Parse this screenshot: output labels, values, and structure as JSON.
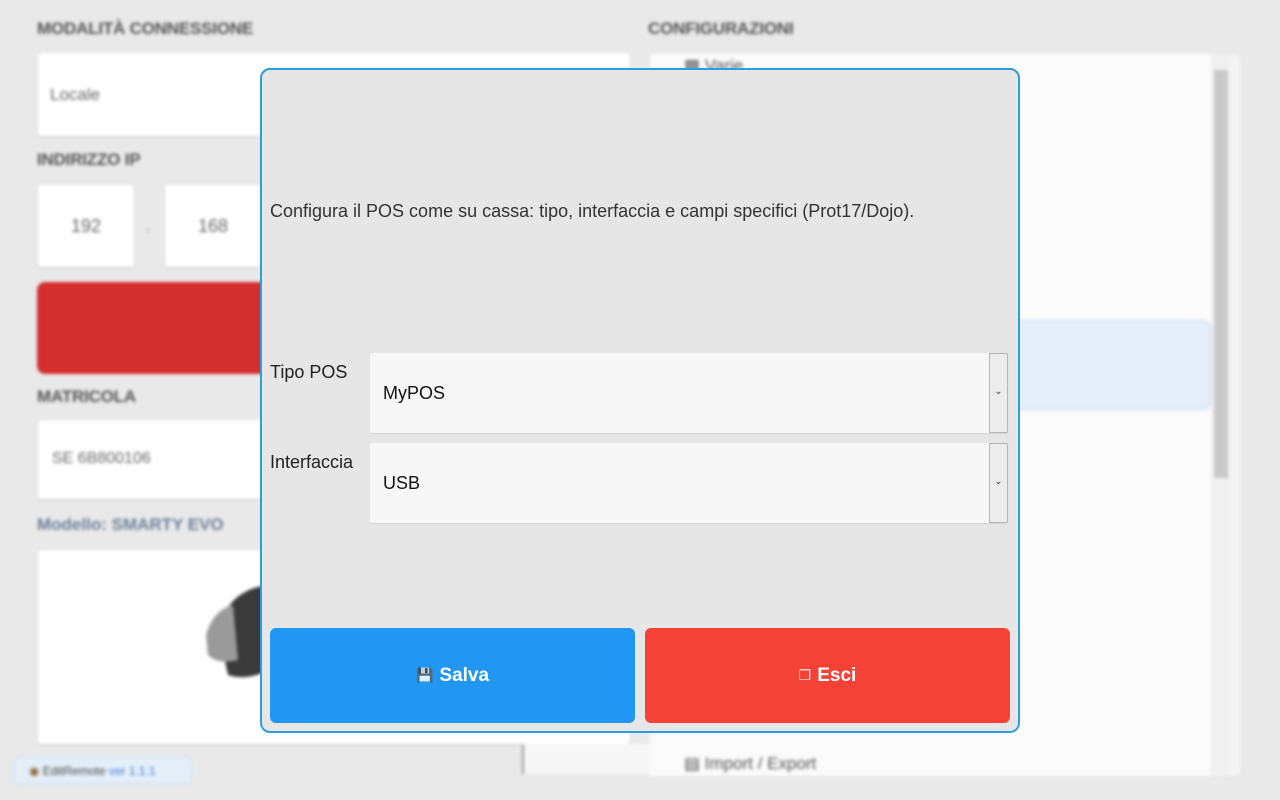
{
  "background": {
    "connection": {
      "title": "MODALITÀ CONNESSIONE",
      "value": "Locale"
    },
    "ip": {
      "title": "INDIRIZZO IP",
      "octets": [
        "192",
        "168"
      ]
    },
    "serial": {
      "title": "MATRICOLA",
      "value": "SE 6B800106"
    },
    "model": {
      "label": "Modello: SMARTY EVO"
    },
    "configurations": {
      "title": "CONFIGURAZIONI",
      "items": [
        "Varie",
        "Import / Export"
      ]
    },
    "footer": {
      "app": "EditRemote",
      "version": "ver 1.1.1"
    }
  },
  "modal": {
    "description": "Configura il POS come su cassa: tipo, interfaccia e campi specifici (Prot17/Dojo).",
    "fields": {
      "tipo_pos": {
        "label": "Tipo POS",
        "value": "MyPOS"
      },
      "interfaccia": {
        "label": "Interfaccia",
        "value": "USB"
      }
    },
    "buttons": {
      "save": {
        "label": "Salva",
        "icon": "save-icon"
      },
      "exit": {
        "label": "Esci",
        "icon": "exit-icon"
      }
    }
  },
  "colors": {
    "modal_border": "#2a9fe0",
    "save_button": "#2196f3",
    "exit_button": "#f44336",
    "danger_block": "#d32f2f"
  }
}
